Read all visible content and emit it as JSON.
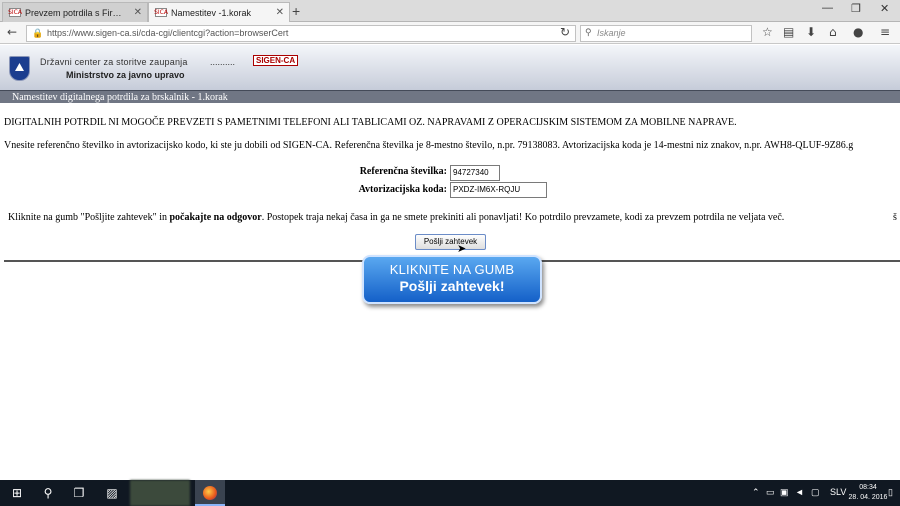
{
  "browser": {
    "tabs": [
      {
        "label": "Prevzem potrdila s Firefox...",
        "favicon": "SICA"
      },
      {
        "label": "Namestitev -1.korak",
        "favicon": "SICA"
      }
    ],
    "url": "https://www.sigen-ca.si/cda-cgi/clientcgi?action=browserCert",
    "search_placeholder": "Iskanje"
  },
  "header": {
    "org_line1": "Državni center za storitve zaupanja",
    "dots": "..........",
    "badge": "SIGEN-CA",
    "org_line2": "Ministrstvo za javno upravo"
  },
  "page": {
    "title": "Namestitev digitalnega potrdila za brskalnik - 1.korak",
    "warning": "DIGITALNIH POTRDIL NI MOGOČE PREVZETI S PAMETNIMI TELEFONI ALI TABLICAMI OZ. NAPRAVAMI Z OPERACIJSKIM SISTEMOM ZA MOBILNE NAPRAVE.",
    "info": "Vnesite referenčno številko in avtorizacijsko kodo, ki ste ju dobili od SIGEN-CA. Referenčna številka je 8-mestno število, n.pr. 79138083. Avtorizacijska koda je 14-mestni niz znakov, n.pr. AWH8-QLUF-9Z86.g",
    "ref_label": "Referenčna številka:",
    "ref_value": "94727340",
    "auth_label": "Avtorizacijska koda:",
    "auth_value": "PXDZ-IM6X-RQJU",
    "instr_prefix": "Kliknite na gumb \"Pošljite zahtevek\" in ",
    "instr_bold": "počakajte na odgovor",
    "instr_suffix": ". Postopek traja nekaj časa in ga ne smete prekiniti ali ponavljati! Ko potrdilo prevzamete, kodi za prevzem potrdila ne veljata več.",
    "instr_right": "š",
    "submit_label": "Pošlji zahtevek"
  },
  "callout": {
    "line1": "KLIKNITE NA GUMB",
    "line2": "Pošlji zahtevek!"
  },
  "taskbar": {
    "lang": "SLV",
    "time": "08:34",
    "date": "28. 04. 2016"
  }
}
